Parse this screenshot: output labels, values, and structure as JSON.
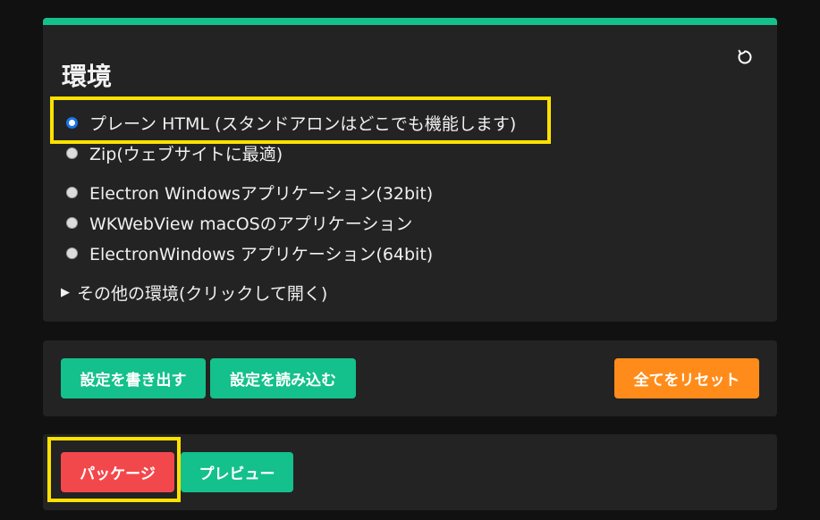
{
  "environment": {
    "title": "環境",
    "options": [
      {
        "label": "プレーン HTML (スタンドアロンはどこでも機能します)",
        "selected": true
      },
      {
        "label": "Zip(ウェブサイトに最適)",
        "selected": false
      },
      {
        "label": "Electron Windowsアプリケーション(32bit)",
        "selected": false
      },
      {
        "label": "WKWebView macOSのアプリケーション",
        "selected": false
      },
      {
        "label": "ElectronWindows アプリケーション(64bit)",
        "selected": false
      }
    ],
    "more_label": "その他の環境(クリックして開く)",
    "accent_color": "#14c08b"
  },
  "settings": {
    "export_label": "設定を書き出す",
    "import_label": "設定を読み込む",
    "reset_all_label": "全てをリセット"
  },
  "package": {
    "package_label": "パッケージ",
    "preview_label": "プレビュー"
  },
  "colors": {
    "green": "#14c08b",
    "orange": "#ff8c1a",
    "red": "#f2484c",
    "highlight": "#ffe100"
  }
}
